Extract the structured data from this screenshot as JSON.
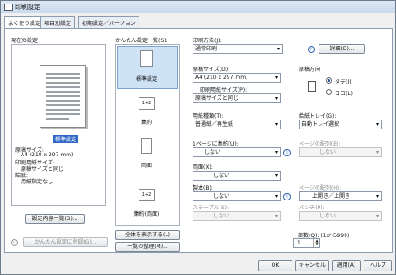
{
  "window": {
    "title": "印刷設定"
  },
  "tabs": [
    "よく使う設定",
    "項目別設定",
    "初期設定／バージョン"
  ],
  "left": {
    "current_settings_label": "現在の設定",
    "summary_badge": "標準設定",
    "summary_lines": [
      "原稿サイズ:",
      "A4 (210 x 297 mm)",
      "印刷用紙サイズ:",
      "原稿サイズと同じ",
      "給紙:",
      "用紙指定なし"
    ],
    "list_button": "設定内容一覧(G)...",
    "register_button": "かんたん設定に登録(G)..."
  },
  "favorites": {
    "title": "かんたん設定一覧(S):",
    "items": [
      "標準設定",
      "集約",
      "両面",
      "集約(両面)"
    ],
    "icon_text": [
      "",
      "1+2",
      "",
      "1+2"
    ],
    "show_all_button": "全体を表示する(L)",
    "manage_button": "一覧の整理(M)..."
  },
  "right": {
    "print_method_label": "印刷方法(J):",
    "print_method_value": "通常印刷",
    "details_button": "詳細(D)...",
    "paper_size_label": "原稿サイズ(D):",
    "paper_size_value": "A4 (210 x 297 mm)",
    "output_size_label": "印刷用紙サイズ(P):",
    "output_size_value": "原稿サイズと同じ",
    "orientation_label": "原稿方向",
    "portrait_label": "タテ(I)",
    "landscape_label": "ヨコ(L)",
    "paper_type_label": "用紙種類(T):",
    "paper_type_value": "普通紙／再生紙",
    "tray_label": "給紙トレイ(G):",
    "tray_value": "自動トレイ選択",
    "pages_per_sheet_label": "1ページに集約(U):",
    "pages_per_sheet_value": "しない",
    "page_order_label": "ページの配列(E):",
    "page_order_value": "しない",
    "duplex_label": "両面(X):",
    "duplex_value": "しない",
    "booklet_label": "製本(B):",
    "booklet_value": "しない",
    "binding_label": "ページの配列(H):",
    "binding_value": "上開き／上開き",
    "staple_label": "ステープル(S):",
    "staple_value": "しない",
    "punch_label": "パンチ(P):",
    "punch_value": "しない",
    "copies_label": "部数(Q): (1から999)",
    "copies_value": "1"
  },
  "footer": {
    "ok": "OK",
    "cancel": "キャンセル",
    "apply": "適用(A)",
    "help": "ヘルプ"
  }
}
